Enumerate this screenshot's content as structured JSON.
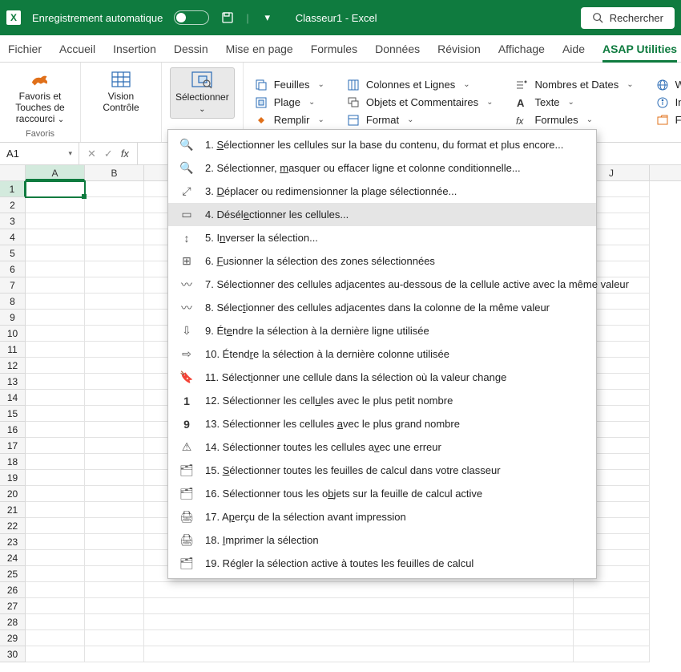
{
  "titlebar": {
    "autosave_label": "Enregistrement automatique",
    "title": "Classeur1 - Excel",
    "search_label": "Rechercher"
  },
  "tabs": [
    {
      "id": "fichier",
      "label": "Fichier"
    },
    {
      "id": "accueil",
      "label": "Accueil"
    },
    {
      "id": "insertion",
      "label": "Insertion"
    },
    {
      "id": "dessin",
      "label": "Dessin"
    },
    {
      "id": "miseenpage",
      "label": "Mise en page"
    },
    {
      "id": "formules",
      "label": "Formules"
    },
    {
      "id": "donnees",
      "label": "Données"
    },
    {
      "id": "revision",
      "label": "Révision"
    },
    {
      "id": "affichage",
      "label": "Affichage"
    },
    {
      "id": "aide",
      "label": "Aide"
    },
    {
      "id": "asap",
      "label": "ASAP Utilities",
      "active": true
    }
  ],
  "ribbon": {
    "favoris": {
      "label": "Favoris et Touches de raccourci",
      "group_label": "Favoris"
    },
    "vision": {
      "label": "Vision Contrôle"
    },
    "selectionner": {
      "label": "Sélectionner"
    },
    "col1": [
      {
        "id": "feuilles",
        "label": "Feuilles"
      },
      {
        "id": "plage",
        "label": "Plage"
      },
      {
        "id": "remplir",
        "label": "Remplir"
      }
    ],
    "col2": [
      {
        "id": "colonnes",
        "label": "Colonnes et Lignes"
      },
      {
        "id": "objets",
        "label": "Objets et Commentaires"
      },
      {
        "id": "format",
        "label": "Format"
      }
    ],
    "col3": [
      {
        "id": "nombres",
        "label": "Nombres et Dates"
      },
      {
        "id": "texte",
        "label": "Texte"
      },
      {
        "id": "formulesg",
        "label": "Formules"
      }
    ],
    "col4": [
      {
        "id": "web",
        "label": "Web"
      },
      {
        "id": "informations",
        "label": "Informations"
      },
      {
        "id": "fichier",
        "label": "Fichier et Système"
      }
    ]
  },
  "formula": {
    "name_box": "A1"
  },
  "columns": [
    "A",
    "B",
    "J"
  ],
  "rows_count": 30,
  "menu": {
    "items": [
      {
        "n": "1.",
        "pre": "",
        "u": "S",
        "post": "électionner les cellules sur la base du contenu, du format et plus encore..."
      },
      {
        "n": "2.",
        "pre": "Sélectionner, ",
        "u": "m",
        "post": "asquer ou effacer ligne et colonne conditionnelle..."
      },
      {
        "n": "3.",
        "pre": "",
        "u": "D",
        "post": "éplacer ou redimensionner la plage sélectionnée..."
      },
      {
        "n": "4.",
        "pre": "Désél",
        "u": "e",
        "post": "ctionner les cellules...",
        "hover": true
      },
      {
        "n": "5.",
        "pre": "I",
        "u": "n",
        "post": "verser la sélection..."
      },
      {
        "n": "6.",
        "pre": "",
        "u": "F",
        "post": "usionner la sélection des zones sélectionnées"
      },
      {
        "n": "7.",
        "pre": "Sélectionner des cellules ad",
        "u": "j",
        "post": "acentes au-dessous de la cellule active avec la même valeur"
      },
      {
        "n": "8.",
        "pre": "Sélec",
        "u": "t",
        "post": "ionner des cellules adjacentes dans la colonne de la même valeur"
      },
      {
        "n": "9.",
        "pre": "Ét",
        "u": "e",
        "post": "ndre la sélection à la dernière ligne utilisée"
      },
      {
        "n": "10.",
        "pre": "Étend",
        "u": "r",
        "post": "e la sélection à la dernière colonne utilisée"
      },
      {
        "n": "11.",
        "pre": "Sélect",
        "u": "i",
        "post": "onner une cellule dans la sélection où la valeur change"
      },
      {
        "n": "12.",
        "pre": "Sélectionner les cell",
        "u": "u",
        "post": "les avec le plus petit nombre"
      },
      {
        "n": "13.",
        "pre": "Sélectionner les cellules ",
        "u": "a",
        "post": "vec le plus grand nombre"
      },
      {
        "n": "14.",
        "pre": "Sélectionner toutes les cellules a",
        "u": "v",
        "post": "ec une erreur"
      },
      {
        "n": "15.",
        "pre": "",
        "u": "S",
        "post": "électionner toutes les feuilles de calcul dans votre classeur"
      },
      {
        "n": "16.",
        "pre": "Sélectionner tous les o",
        "u": "b",
        "post": "jets sur la feuille de calcul active"
      },
      {
        "n": "17.",
        "pre": "A",
        "u": "p",
        "post": "erçu de la sélection avant impression"
      },
      {
        "n": "18.",
        "pre": "",
        "u": "I",
        "post": "mprimer la sélection"
      },
      {
        "n": "19.",
        "pre": "Ré",
        "u": "g",
        "post": "ler la sélection active à toutes les feuilles de calcul"
      }
    ],
    "icons": [
      "🔍",
      "🔍",
      "⤢",
      "▭",
      "↕",
      "⊞",
      "〰",
      "〰",
      "⇩",
      "⇨",
      "🔖",
      "1",
      "9",
      "⚠",
      "🗂",
      "🗂",
      "🖨",
      "🖨",
      "🗂"
    ]
  }
}
